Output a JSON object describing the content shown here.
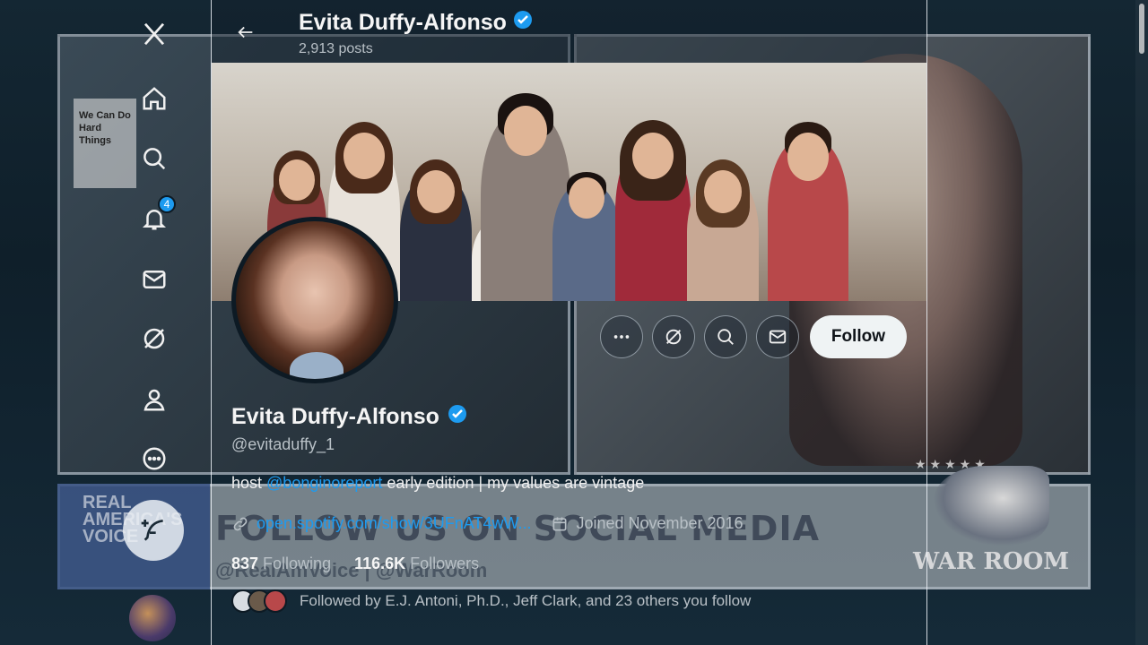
{
  "sidebar": {
    "notification_count": "4",
    "items": [
      {
        "name": "home"
      },
      {
        "name": "explore"
      },
      {
        "name": "notifications"
      },
      {
        "name": "messages"
      },
      {
        "name": "grok"
      },
      {
        "name": "profile"
      },
      {
        "name": "more"
      }
    ]
  },
  "header": {
    "name": "Evita Duffy-Alfonso",
    "posts": "2,913 posts"
  },
  "actions": {
    "follow_label": "Follow"
  },
  "profile": {
    "name": "Evita Duffy-Alfonso",
    "handle": "@evitaduffy_1",
    "bio_prefix": "host ",
    "bio_mention": "@bonginoreport",
    "bio_suffix": " early edition | my values are vintage",
    "link": "open.spotify.com/show/3UFnAT4wW...",
    "joined": "Joined November 2016",
    "following_count": "837",
    "following_label": "Following",
    "followers_count": "116.6K",
    "followers_label": "Followers",
    "followed_by": "Followed by E.J. Antoni, Ph.D., Jeff Clark, and 23 others you follow"
  },
  "background": {
    "rav_text": "REAL AMERICA'S VOICE",
    "ticker_text": "FOLLOW US ON SOCIAL MEDIA",
    "ticker_sub": "@RealAmVoice | @WarRoom",
    "warroom_text": "WAR ROOM",
    "sign_text": "We Can Do Hard Things"
  },
  "colors": {
    "accent": "#1d9bf0",
    "follow_bg": "#eff3f4"
  }
}
